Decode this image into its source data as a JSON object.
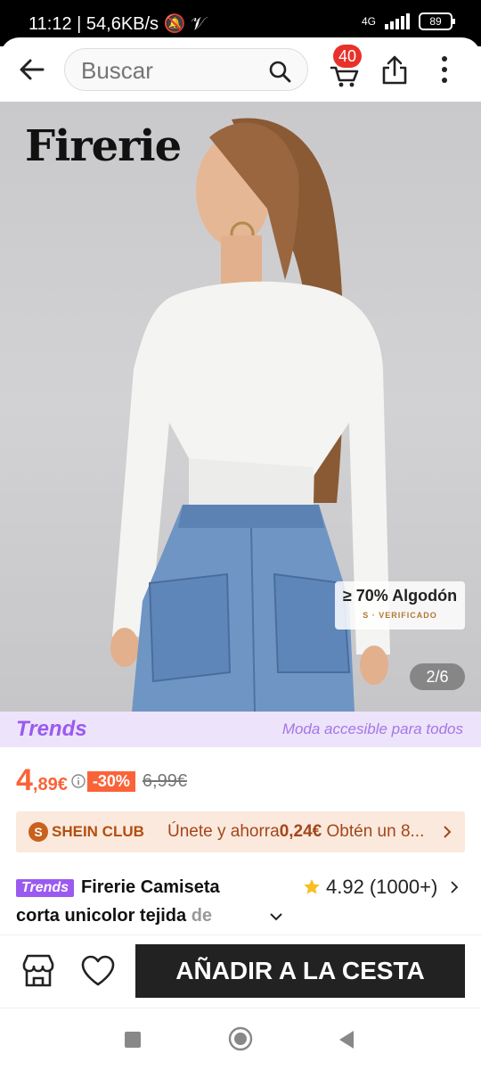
{
  "status": {
    "time": "11:12",
    "speed": "| 54,6KB/s",
    "network": "4G",
    "battery": "89"
  },
  "header": {
    "search_placeholder": "Buscar",
    "cart_count": "40"
  },
  "gallery": {
    "brand": "Firerie",
    "material": "≥ 70% Algodón",
    "verified": "S · VERIFICADO",
    "counter": "2/6"
  },
  "trends": {
    "logo": "Trends",
    "tagline": "Moda accesible para todos"
  },
  "price": {
    "integer": "4",
    "decimal": ",89€",
    "discount": "-30%",
    "original": "6,99€"
  },
  "club": {
    "icon": "S",
    "label": "SHEIN CLUB",
    "text_pre": "Únete y ahorra",
    "amount": "0,24€",
    "text_post": " Obtén un 8..."
  },
  "product": {
    "tag": "Trends",
    "title_line1": "Firerie Camiseta",
    "title_line2": "corta unicolor tejida",
    "title_fade": " de",
    "rating": "4.92",
    "rating_count": "(1000+)"
  },
  "actions": {
    "add_to_cart": "AÑADIR A LA CESTA"
  },
  "colors": {
    "accent": "#fa6338",
    "trends": "#9a5af0",
    "button": "#222222"
  }
}
